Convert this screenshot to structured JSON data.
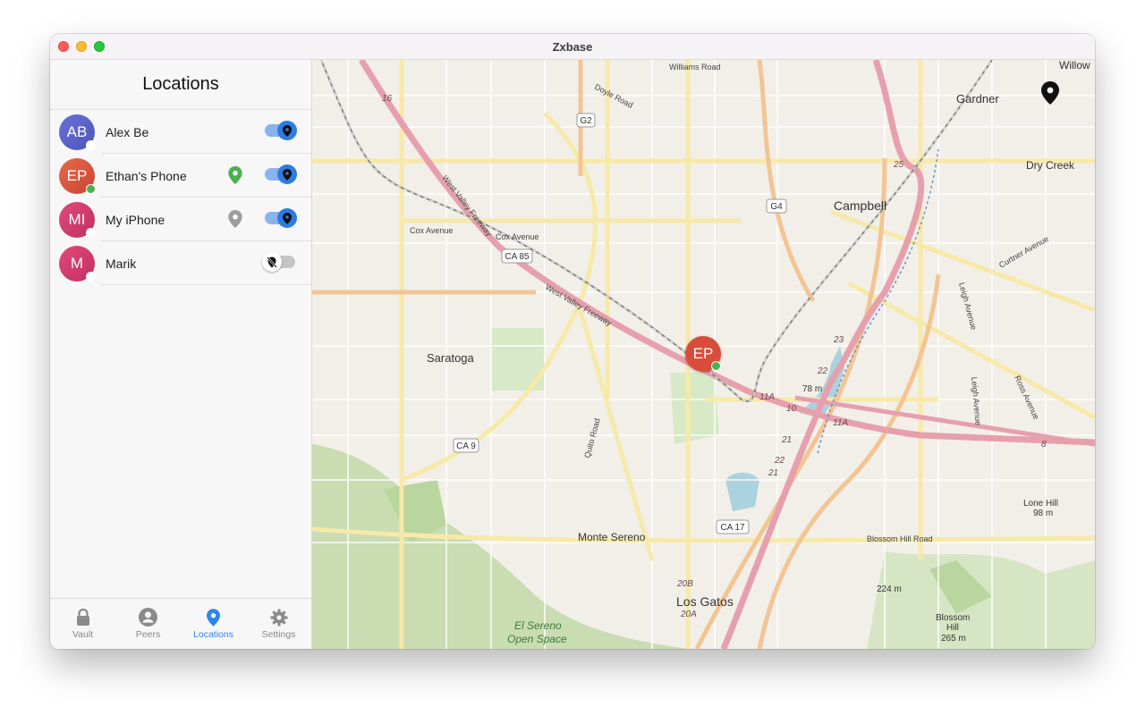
{
  "window": {
    "title": "Zxbase"
  },
  "sidebar": {
    "title": "Locations",
    "peers": [
      {
        "initials": "AB",
        "name": "Alex Be",
        "color": "#5a64c8",
        "online": false,
        "pin": "",
        "sharing": true
      },
      {
        "initials": "EP",
        "name": "Ethan's Phone",
        "color": "#d9553f",
        "online": true,
        "pin": "green",
        "sharing": true
      },
      {
        "initials": "MI",
        "name": "My iPhone",
        "color": "#d43a6e",
        "online": false,
        "pin": "gray",
        "sharing": true
      },
      {
        "initials": "M",
        "name": "Marik",
        "color": "#d63b6b",
        "online": false,
        "pin": "",
        "sharing": false
      }
    ]
  },
  "tabs": [
    {
      "label": "Vault",
      "icon": "lock-icon",
      "active": false
    },
    {
      "label": "Peers",
      "icon": "person-icon",
      "active": false
    },
    {
      "label": "Locations",
      "icon": "location-pin-icon",
      "active": true
    },
    {
      "label": "Settings",
      "icon": "gear-icon",
      "active": false
    }
  ],
  "map": {
    "marker": {
      "initials": "EP"
    },
    "places": {
      "gardner": "Gardner",
      "willow": "Willow",
      "dry_creek": "Dry Creek",
      "campbell": "Campbell",
      "saratoga": "Saratoga",
      "monte_sereno": "Monte Sereno",
      "los_gatos": "Los Gatos",
      "lone_hill": "Lone Hill",
      "lone_hill_elev": "98 m",
      "blossom_hill": "Blossom",
      "blossom_hill2": "Hill",
      "blossom_hill_elev": "265 m",
      "el_sereno": "El Sereno",
      "open_space": "Open Space",
      "elev_224": "224 m",
      "elev_78": "78 m"
    },
    "roads": {
      "williams": "Williams Road",
      "doyle": "Doyle Road",
      "cox1": "Cox Avenue",
      "cox2": "Cox Avenue",
      "wvf1": "West Valley Freeway",
      "wvf2": "West Valley Freeway",
      "quito": "Quito Road",
      "curtner": "Curtner Avenue",
      "leigh1": "Leigh Avenue",
      "leigh2": "Leigh Avenue",
      "ross": "Ross Avenue",
      "blossom_rd": "Blossom Hill Road"
    },
    "shields": {
      "g2": "G2",
      "g4": "G4",
      "ca85": "CA 85",
      "ca9": "CA 9",
      "ca17": "CA 17"
    },
    "route_nums": {
      "r16": "16",
      "r25": "25",
      "r23": "23",
      "r22a": "22",
      "r22b": "22",
      "r21a": "21",
      "r21b": "21",
      "r11a": "11A",
      "r11b": "11A",
      "r10": "10",
      "r20b": "20B",
      "r20a": "20A",
      "r8": "8"
    }
  }
}
